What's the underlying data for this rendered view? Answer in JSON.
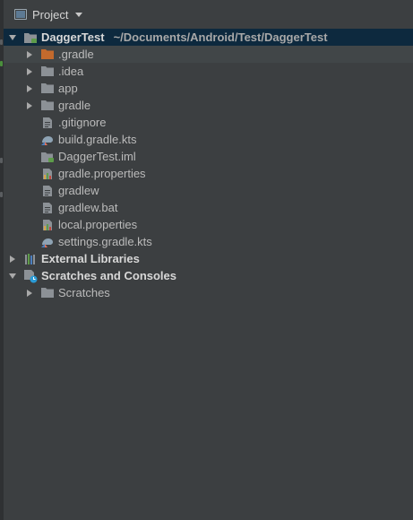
{
  "panel": {
    "title": "Project"
  },
  "tree": {
    "root": {
      "name": "DaggerTest",
      "path": "~/Documents/Android/Test/DaggerTest"
    },
    "children": [
      {
        "label": ".gradle"
      },
      {
        "label": ".idea"
      },
      {
        "label": "app"
      },
      {
        "label": "gradle"
      },
      {
        "label": ".gitignore"
      },
      {
        "label": "build.gradle.kts"
      },
      {
        "label": "DaggerTest.iml"
      },
      {
        "label": "gradle.properties"
      },
      {
        "label": "gradlew"
      },
      {
        "label": "gradlew.bat"
      },
      {
        "label": "local.properties"
      },
      {
        "label": "settings.gradle.kts"
      }
    ],
    "external_libraries": "External Libraries",
    "scratches_consoles": "Scratches and Consoles",
    "scratches": "Scratches"
  },
  "colors": {
    "background": "#3c3f41",
    "selection": "#0d293e",
    "folder": "#8c9196",
    "excluded_folder": "#c36a2d",
    "text": "#bbbbbb"
  }
}
